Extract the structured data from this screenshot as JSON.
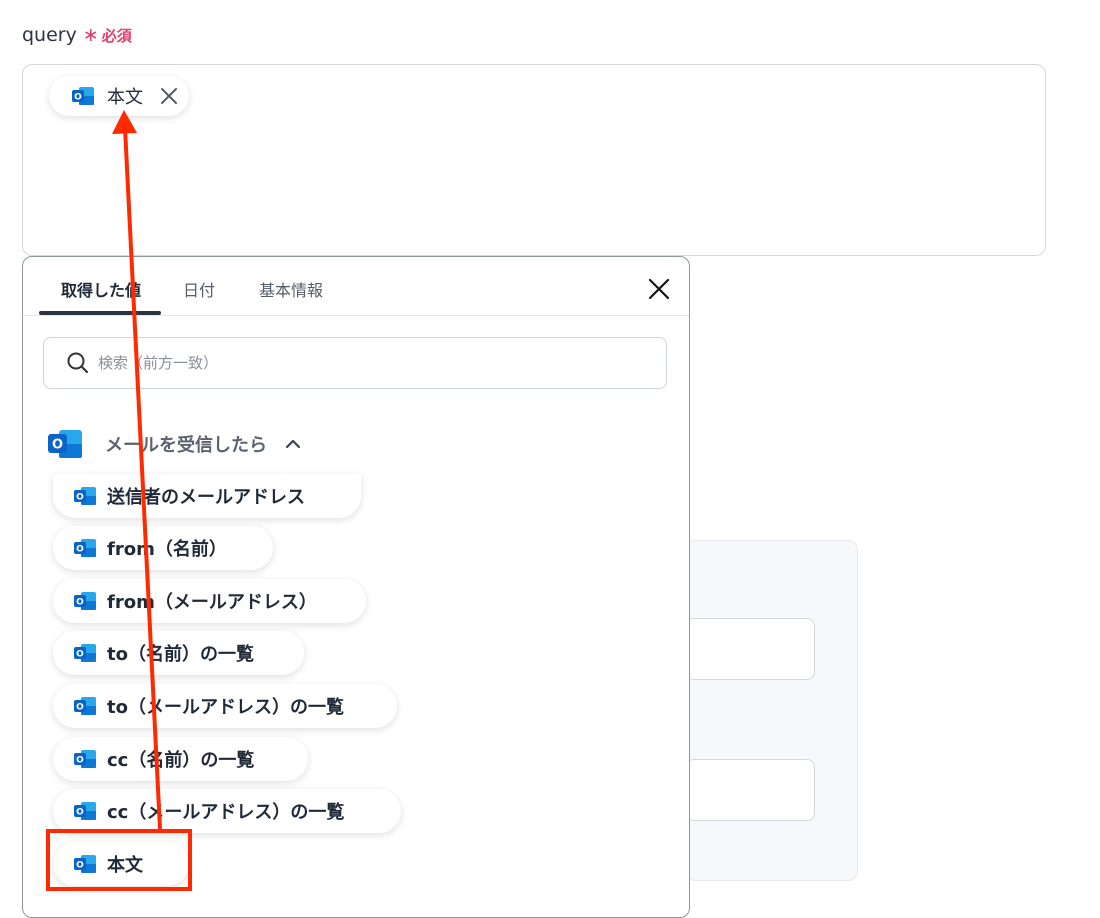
{
  "field": {
    "name": "query",
    "required_mark": "∗",
    "required_text": "必須"
  },
  "query_chip": {
    "label": "本文"
  },
  "tabs": [
    {
      "label": "取得した値",
      "active": true
    },
    {
      "label": "日付",
      "active": false
    },
    {
      "label": "基本情報",
      "active": false
    }
  ],
  "search": {
    "placeholder": "検索（前方一致）"
  },
  "group": {
    "title": "メールを受信したら"
  },
  "items": [
    {
      "label": "送信者のメールアドレス"
    },
    {
      "label": "from（名前）"
    },
    {
      "label": "from（メールアドレス）"
    },
    {
      "label": "to（名前）の一覧"
    },
    {
      "label": "to（メールアドレス）の一覧"
    },
    {
      "label": "cc（名前）の一覧"
    },
    {
      "label": "cc（メールアドレス）の一覧"
    },
    {
      "label": "本文"
    }
  ],
  "colors": {
    "accent_required": "#e0406a",
    "annotation": "#ff2a00",
    "outlook_blue": "#0a64c8"
  },
  "icons": {
    "app": "outlook-icon",
    "remove": "close-icon",
    "search": "search-icon",
    "collapse": "chevron-up-icon"
  }
}
